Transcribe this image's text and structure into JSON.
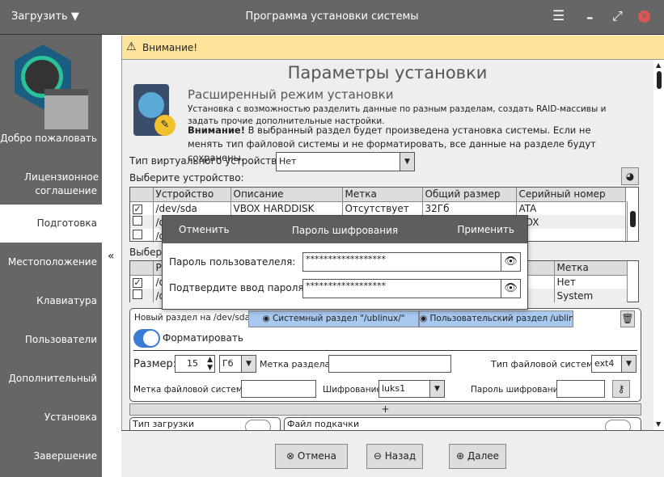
{
  "titlebar": {
    "load_menu": "Загрузить",
    "title": "Программа установки системы"
  },
  "sidebar": {
    "collapse": "«",
    "items": [
      {
        "label": "Добро пожаловать"
      },
      {
        "label": "Лицензионное соглашение"
      },
      {
        "label": "Подготовка"
      },
      {
        "label": "Местоположение"
      },
      {
        "label": "Клавиатура"
      },
      {
        "label": "Пользователи"
      },
      {
        "label": "Дополнительный"
      },
      {
        "label": "Установка"
      },
      {
        "label": "Завершение"
      }
    ]
  },
  "warning": {
    "text": "Внимание!"
  },
  "main": {
    "title": "Параметры установки",
    "mode_title": "Расширенный режим установки",
    "mode_desc": "Установка с возможностью разделить данные по разным разделам, создать RAID-массивы и задать прочие дополнительные настройки.",
    "attention_bold": "Внимание!",
    "attention_text": " В выбранный раздел будет произведена установка системы. Если не менять тип файловой системы и не форматировать, все данные на разделе будут сохранены.",
    "virt_label": "Тип виртуального устройства:",
    "virt_value": "Нет",
    "device_label": "Выберите устройство:",
    "devices": {
      "headers": [
        "Устройство",
        "Описание",
        "Метка",
        "Общий размер",
        "Серийный номер"
      ],
      "rows": [
        {
          "checked": true,
          "cells": [
            "/dev/sda",
            "VBOX HARDDISK",
            "Отсутствует",
            "32Гб",
            "ATA"
          ]
        },
        {
          "checked": false,
          "cells": [
            "/d",
            "",
            "",
            "",
            "BOX"
          ]
        },
        {
          "checked": false,
          "cells": [
            "/d",
            "",
            "",
            "",
            ""
          ]
        }
      ]
    },
    "partition_label": "Выбери",
    "partitions": {
      "headers": [
        "Ра",
        "Метка"
      ],
      "rows": [
        {
          "checked": true,
          "cells": [
            "/d",
            "Нет"
          ]
        },
        {
          "checked": false,
          "cells": [
            "/d",
            "System"
          ]
        }
      ]
    },
    "new_part": {
      "tab_label": "Новый раздел на /dev/sda",
      "sys_tab": "Системный раздел \"/ublinux/\"",
      "user_tab": "Пользовательский раздел /ublinux-data/",
      "format_label": "Форматировать",
      "format_on": true,
      "size_label": "Размер:",
      "size_value": "15",
      "unit": "Гб",
      "part_label": "Метка раздела:",
      "part_value": "",
      "fs_type_label": "Тип файловой системы:",
      "fs_type": "ext4",
      "fs_label": "Метка файловой системы:",
      "fs_label_value": "",
      "enc_label": "Шифрование:",
      "enc_value": "luks1",
      "enc_pass_label": "Пароль шифрования",
      "enc_pass_value": ""
    },
    "add": "+",
    "boot_label": "Тип загрузки",
    "swap_label": "Файл подкачки"
  },
  "dialog": {
    "cancel": "Отменить",
    "title": "Пароль шифрования",
    "apply": "Применить",
    "user_pass_label": "Пароль пользователеля:",
    "user_pass": "******************",
    "confirm_label": "Подтвердите ввод пароля:",
    "confirm_pass": "******************"
  },
  "bottom": {
    "cancel": "Отмена",
    "back": "Назад",
    "next": "Далее"
  },
  "colors": {
    "accent": "#3a7bd5",
    "warning": "#fde49a",
    "tab": "#a8c8f0"
  }
}
